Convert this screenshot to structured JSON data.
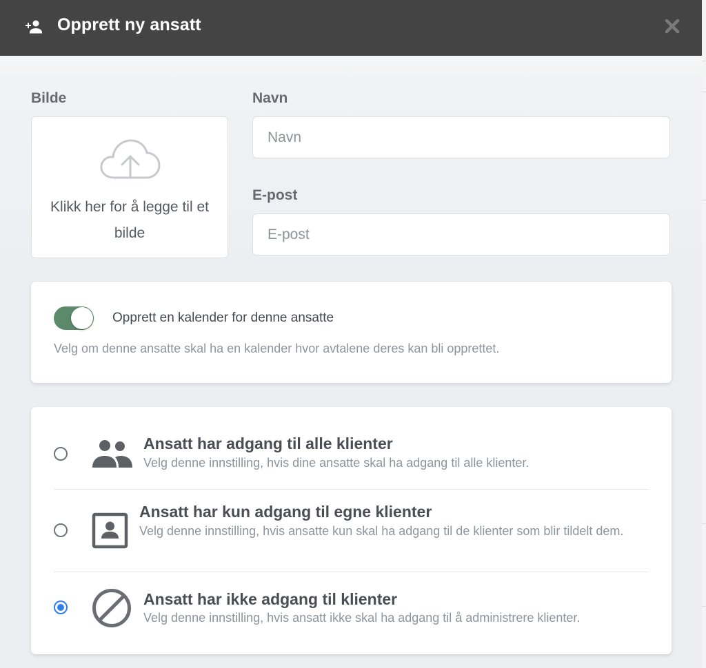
{
  "header": {
    "title": "Opprett ny ansatt",
    "icon": "add-person-icon",
    "close_icon": "close-icon",
    "background": "#444444"
  },
  "image": {
    "label": "Bilde",
    "upload_text": "Klikk her for å legge til et bilde",
    "icon": "cloud-upload-icon"
  },
  "name": {
    "label": "Navn",
    "placeholder": "Navn",
    "value": ""
  },
  "email": {
    "label": "E-post",
    "placeholder": "E-post",
    "value": ""
  },
  "calendar": {
    "toggle_on": true,
    "label": "Opprett en kalender for denne ansatte",
    "help": "Velg om denne ansatte skal ha en kalender hvor avtalene deres kan bli opprettet.",
    "toggle_color": "#5b8a6b"
  },
  "access": {
    "selected": "none",
    "accent": "#2f7fe8",
    "options": [
      {
        "id": "all",
        "icon": "group-icon",
        "title": "Ansatt har adgang til alle klienter",
        "description": "Velg denne innstilling, hvis dine ansatte skal ha adgang til alle klienter."
      },
      {
        "id": "own",
        "icon": "contact-card-icon",
        "title": "Ansatt har kun adgang til egne klienter",
        "description": "Velg denne innstilling, hvis ansatte kun skal ha adgang til de klienter som blir tildelt dem."
      },
      {
        "id": "none",
        "icon": "block-icon",
        "title": "Ansatt har ikke adgang til klienter",
        "description": "Velg denne innstilling, hvis ansatt ikke skal ha adgang til å administrere klienter."
      }
    ]
  }
}
